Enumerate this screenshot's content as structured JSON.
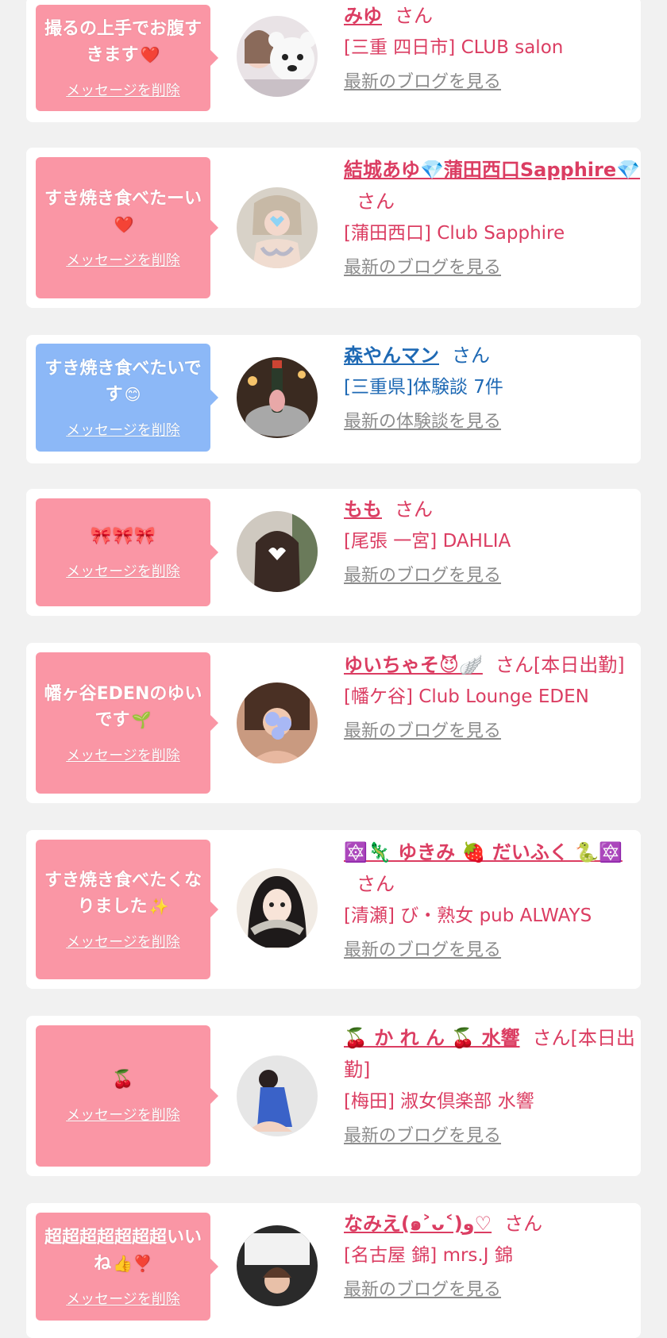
{
  "items": [
    {
      "message": "撮るの上手でお腹すきます",
      "message_icon": "heart-icon",
      "delete_label": "メッセージを削除",
      "name": "みゆ",
      "suffix": "さん",
      "shop": "[三重 四日市] CLUB salon",
      "link": "最新のブログを見る",
      "color": "pink",
      "accent": "#fa96a5",
      "text_color": "#db3d62",
      "avatar_icon": "avatar-bear-mask"
    },
    {
      "message": "すき焼き食べたーい",
      "message_icon": "heart-icon",
      "delete_label": "メッセージを削除",
      "name": "結城あゆ💎蒲田西口Sapphire💎",
      "suffix": "さん",
      "shop": "[蒲田西口] Club Sapphire",
      "link": "最新のブログを見る",
      "color": "pink",
      "accent": "#fa96a5",
      "text_color": "#db3d62",
      "avatar_icon": "avatar-bikini"
    },
    {
      "message": "すき焼き食べたいです",
      "message_icon": "smile-icon",
      "delete_label": "メッセージを削除",
      "name": "森やんマン",
      "suffix": "さん",
      "shop": "[三重県]体験談 7件",
      "link": "最新の体験談を見る",
      "color": "blue",
      "accent": "#8cb8f7",
      "text_color": "#1e69b4",
      "avatar_icon": "avatar-champagne"
    },
    {
      "message": "🎀🎀🎀",
      "message_icon": "",
      "delete_label": "メッセージを削除",
      "name": "もも",
      "suffix": "さん",
      "shop": "[尾張 一宮] DAHLIA",
      "link": "最新のブログを見る",
      "color": "pink",
      "accent": "#fa96a5",
      "text_color": "#db3d62",
      "avatar_icon": "avatar-heart-mask"
    },
    {
      "message": "幡ヶ谷EDENのゆいです",
      "message_icon": "sprout-icon",
      "delete_label": "メッセージを削除",
      "name": "ゆいちゃそ😈🪽",
      "suffix": "さん[本日出勤]",
      "shop": "[幡ケ谷] Club Lounge EDEN",
      "link": "最新のブログを見る",
      "color": "pink",
      "accent": "#fa96a5",
      "text_color": "#db3d62",
      "avatar_icon": "avatar-flower-mask"
    },
    {
      "message": "すき焼き食べたくなりました",
      "message_icon": "sparkle-icon",
      "delete_label": "メッセージを削除",
      "name": "🔯🦎 ゆきみ 🍓 だいふく 🐍🔯",
      "suffix": "さん",
      "shop": "[清瀬] び・熟女 pub ALWAYS",
      "link": "最新のブログを見る",
      "color": "pink",
      "accent": "#fa96a5",
      "text_color": "#db3d62",
      "avatar_icon": "avatar-anime-girl"
    },
    {
      "message": "🍒",
      "message_icon": "",
      "delete_label": "メッセージを削除",
      "name": "🍒 か れ ん 🍒 水響",
      "suffix": "さん[本日出勤]",
      "shop": "[梅田] 淑女倶楽部 水響",
      "link": "最新のブログを見る",
      "color": "pink",
      "accent": "#fa96a5",
      "text_color": "#db3d62",
      "avatar_icon": "avatar-blue-dress"
    },
    {
      "message": "超超超超超超超いいね",
      "message_icon": "thumbs-heart-icon",
      "delete_label": "メッセージを削除",
      "name": "なみえ(๑˃ᴗ˂)ﻭ♡",
      "suffix": "さん",
      "shop": "[名古屋 錦] mrs.J 錦",
      "link": "最新のブログを見る",
      "color": "pink",
      "accent": "#fa96a5",
      "text_color": "#db3d62",
      "avatar_icon": "avatar-store-front"
    }
  ]
}
